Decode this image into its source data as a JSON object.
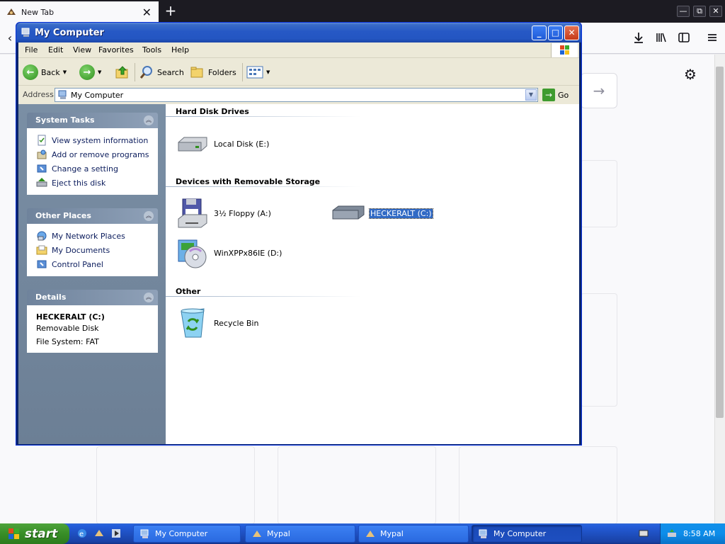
{
  "browser": {
    "tab_title": "New Tab",
    "tab_close": "✕",
    "new_tab": "+",
    "minimize": "—",
    "restore": "⧉",
    "close": "✕"
  },
  "window": {
    "title": "My Computer",
    "min": "_",
    "max": "□",
    "close": "✕"
  },
  "menu": [
    "File",
    "Edit",
    "View",
    "Favorites",
    "Tools",
    "Help"
  ],
  "toolbar": {
    "back": "Back",
    "search": "Search",
    "folders": "Folders"
  },
  "address": {
    "label": "Address",
    "value": "My Computer",
    "go": "Go"
  },
  "task_pane": {
    "system_tasks": {
      "title": "System Tasks",
      "links": [
        "View system information",
        "Add or remove programs",
        "Change a setting",
        "Eject this disk"
      ]
    },
    "other_places": {
      "title": "Other Places",
      "links": [
        "My Network Places",
        "My Documents",
        "Control Panel"
      ]
    },
    "details": {
      "title": "Details",
      "name": "HECKERALT (C:)",
      "type": "Removable Disk",
      "fs": "File System: FAT"
    }
  },
  "content": {
    "sections": [
      "Hard Disk Drives",
      "Devices with Removable Storage",
      "Other"
    ],
    "items": {
      "local_disk": "Local Disk (E:)",
      "floppy": "3½ Floppy (A:)",
      "heckeralt": "HECKERALT (C:)",
      "cdrom": "WinXPPx86IE (D:)",
      "recycle": "Recycle Bin"
    }
  },
  "taskbar": {
    "start": "start",
    "buttons": [
      "My Computer",
      "Mypal",
      "Mypal",
      "My Computer"
    ],
    "clock": "8:58 AM"
  }
}
